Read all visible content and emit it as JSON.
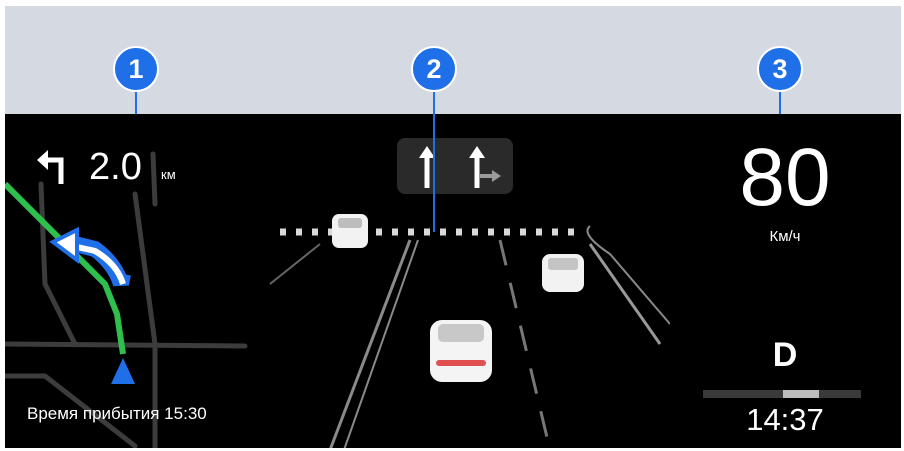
{
  "callouts": [
    "1",
    "2",
    "3"
  ],
  "navigation": {
    "turn_icon": "turn-left-arrow-icon",
    "distance_value": "2.0",
    "distance_unit": "км",
    "map_arrow_icon": "route-turn-arrow-icon",
    "position_icon": "vehicle-position-icon",
    "eta_text": "Время прибытия 15:30",
    "route_color": "#2fbf4d",
    "arrow_color": "#1f6fe8"
  },
  "lanes": {
    "icons": [
      "lane-straight-icon",
      "lane-straight-right-icon"
    ]
  },
  "speed": {
    "value": "80",
    "unit": "Км/ч"
  },
  "drive": {
    "gear": "D",
    "time": "14:37"
  },
  "colors": {
    "background": "#000000",
    "banner": "#d5d9e2",
    "callout": "#1f6fe8"
  }
}
